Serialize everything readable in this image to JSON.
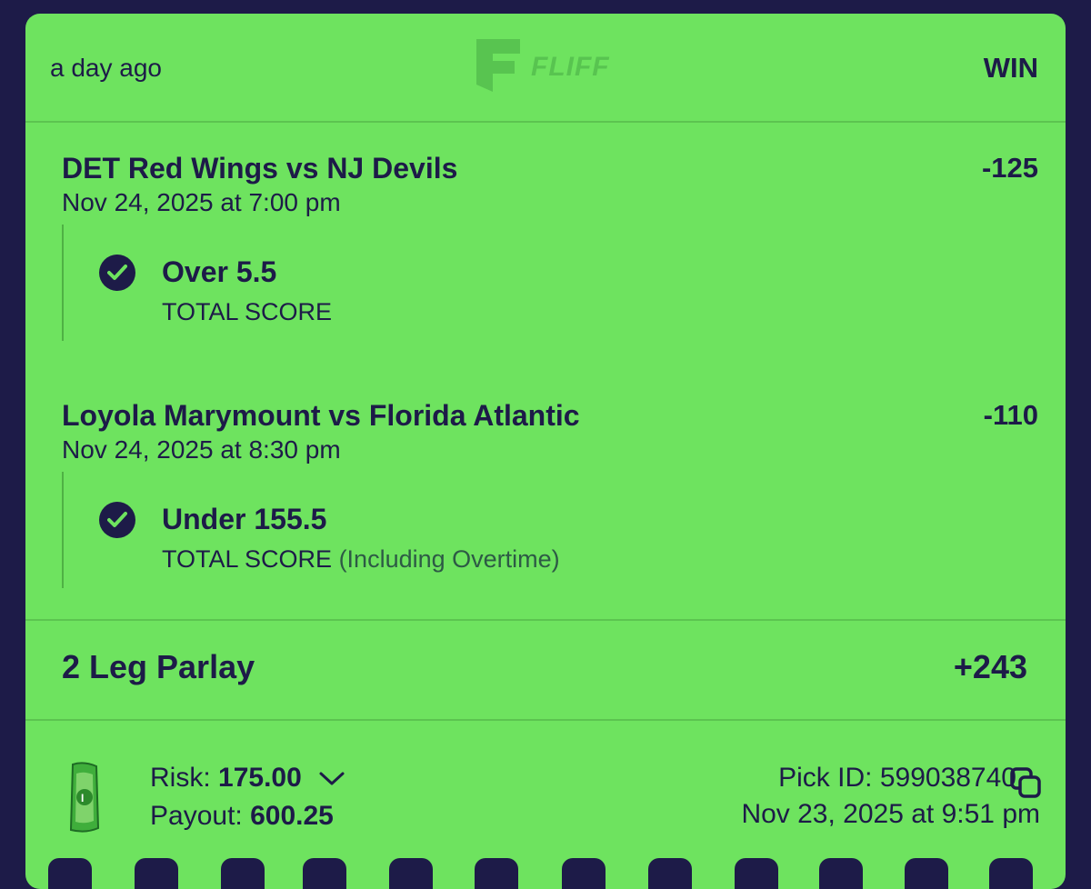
{
  "header": {
    "time_ago": "a day ago",
    "brand": "FLIFF",
    "status": "WIN"
  },
  "legs": [
    {
      "game": "DET Red Wings vs NJ Devils",
      "date": "Nov 24, 2025 at 7:00 pm",
      "odds": "-125",
      "pick": "Over 5.5",
      "market": "TOTAL SCORE",
      "market_note": ""
    },
    {
      "game": "Loyola Marymount vs Florida Atlantic",
      "date": "Nov 24, 2025 at 8:30 pm",
      "odds": "-110",
      "pick": "Under 155.5",
      "market": "TOTAL SCORE",
      "market_note": "(Including Overtime)"
    }
  ],
  "parlay": {
    "label": "2 Leg Parlay",
    "odds": "+243"
  },
  "footer": {
    "risk_label": "Risk:",
    "risk_value": "175.00",
    "payout_label": "Payout:",
    "payout_value": "600.25",
    "pick_id_label": "Pick ID:",
    "pick_id": "599038740",
    "placed_at": "Nov 23, 2025 at 9:51 pm"
  },
  "icons": {
    "check": "check-circle-icon",
    "chevron": "chevron-down-icon",
    "copy": "copy-icon",
    "cash": "cash-icon",
    "logo": "fliff-logo-icon"
  },
  "colors": {
    "ticket_bg": "#6ee35f",
    "text": "#1d1b48",
    "page_bg": "#1d1b48"
  }
}
